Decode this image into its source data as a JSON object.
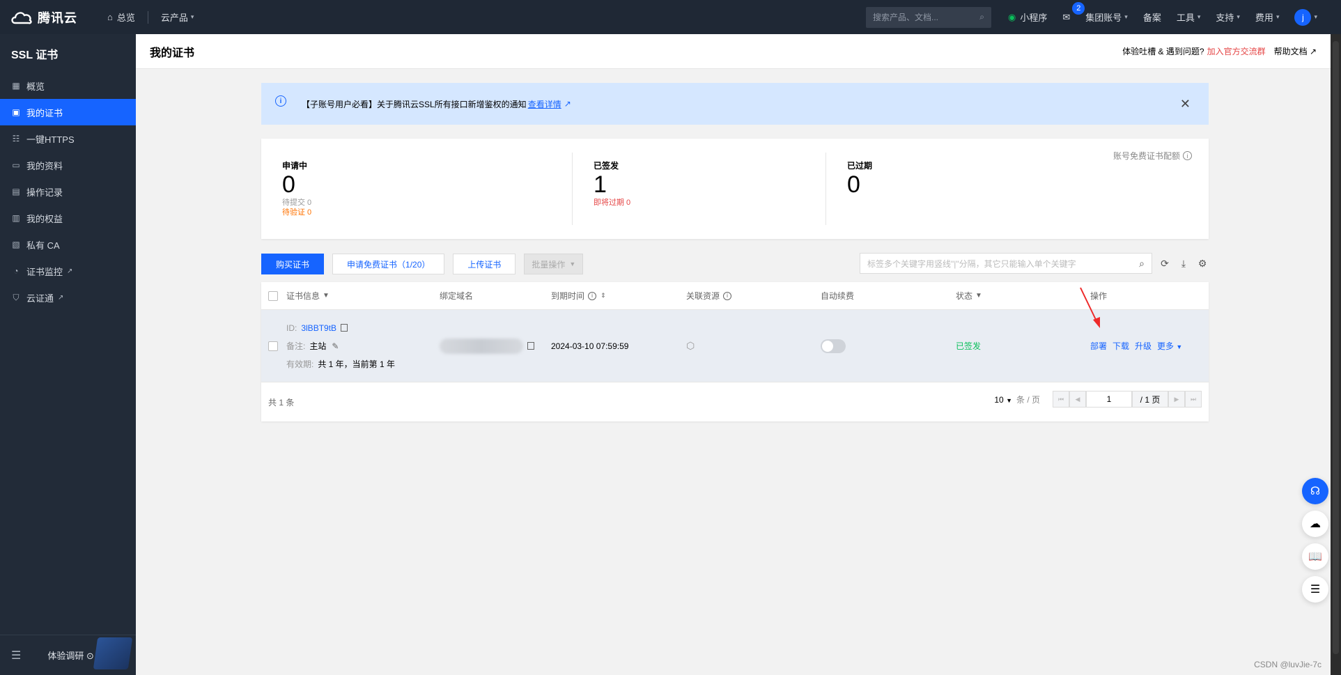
{
  "topbar": {
    "brand": "腾讯云",
    "nav": [
      {
        "label": "总览",
        "icon": "home-icon"
      },
      {
        "label": "云产品",
        "icon": ""
      }
    ],
    "search_placeholder": "搜索产品、文档...",
    "items": [
      {
        "label": "小程序",
        "icon": "miniprogram-icon"
      },
      {
        "label": "",
        "icon": "mail-icon",
        "badge": "2"
      },
      {
        "label": "集团账号",
        "caret": true
      },
      {
        "label": "备案"
      },
      {
        "label": "工具",
        "caret": true
      },
      {
        "label": "支持",
        "caret": true
      },
      {
        "label": "费用",
        "caret": true
      }
    ],
    "avatar": "j"
  },
  "sidebar": {
    "title": "SSL 证书",
    "items": [
      {
        "label": "概览",
        "icon": "grid-icon"
      },
      {
        "label": "我的证书",
        "icon": "certificate-icon",
        "active": true
      },
      {
        "label": "一键HTTPS",
        "icon": "sliders-icon"
      },
      {
        "label": "我的资料",
        "icon": "folder-icon"
      },
      {
        "label": "操作记录",
        "icon": "record-icon"
      },
      {
        "label": "我的权益",
        "icon": "wallet-icon"
      },
      {
        "label": "私有 CA",
        "icon": "ca-icon"
      },
      {
        "label": "证书监控",
        "icon": "monitor-icon",
        "external": true
      },
      {
        "label": "云证通",
        "icon": "shield-icon",
        "external": true
      }
    ],
    "survey": "体验调研"
  },
  "header": {
    "title": "我的证书",
    "feedback": "体验吐槽 & 遇到问题?",
    "join": "加入官方交流群",
    "help": "帮助文档"
  },
  "notice": {
    "text": "【子账号用户必看】关于腾讯云SSL所有接口新增鉴权的通知",
    "link": "查看详情"
  },
  "stats": {
    "quota": "账号免费证书配额",
    "pending": {
      "label": "申请中",
      "value": "0",
      "sub1": "待提交 0",
      "sub2": "待验证 0"
    },
    "issued": {
      "label": "已签发",
      "value": "1",
      "sub1": "即将过期 0"
    },
    "expired": {
      "label": "已过期",
      "value": "0"
    }
  },
  "toolbar": {
    "buy": "购买证书",
    "free": "申请免费证书（1/20）",
    "upload": "上传证书",
    "batch": "批量操作",
    "search_placeholder": "标签多个关键字用竖线\"|\"分隔，其它只能输入单个关键字"
  },
  "table": {
    "columns": [
      "证书信息",
      "绑定域名",
      "到期时间",
      "关联资源",
      "自动续费",
      "状态",
      "操作"
    ],
    "rows": [
      {
        "id_label": "ID:",
        "id": "3lBBT9tB",
        "remark_label": "备注:",
        "remark": "主站",
        "validity_label": "有效期:",
        "validity": "共 1 年，当前第 1 年",
        "expire": "2024-03-10 07:59:59",
        "status": "已签发",
        "ops": [
          "部署",
          "下载",
          "升级",
          "更多"
        ]
      }
    ],
    "total": "共 1 条",
    "page_size": "10",
    "page_size_unit": "条 / 页",
    "page": "1",
    "page_total": "/ 1 页"
  },
  "watermark": "CSDN @luvJie-7c",
  "colors": {
    "primary": "#1664ff",
    "topbar": "#1f2835",
    "sidebar": "#222b38",
    "success": "#0abf5b",
    "danger": "#e54545"
  }
}
